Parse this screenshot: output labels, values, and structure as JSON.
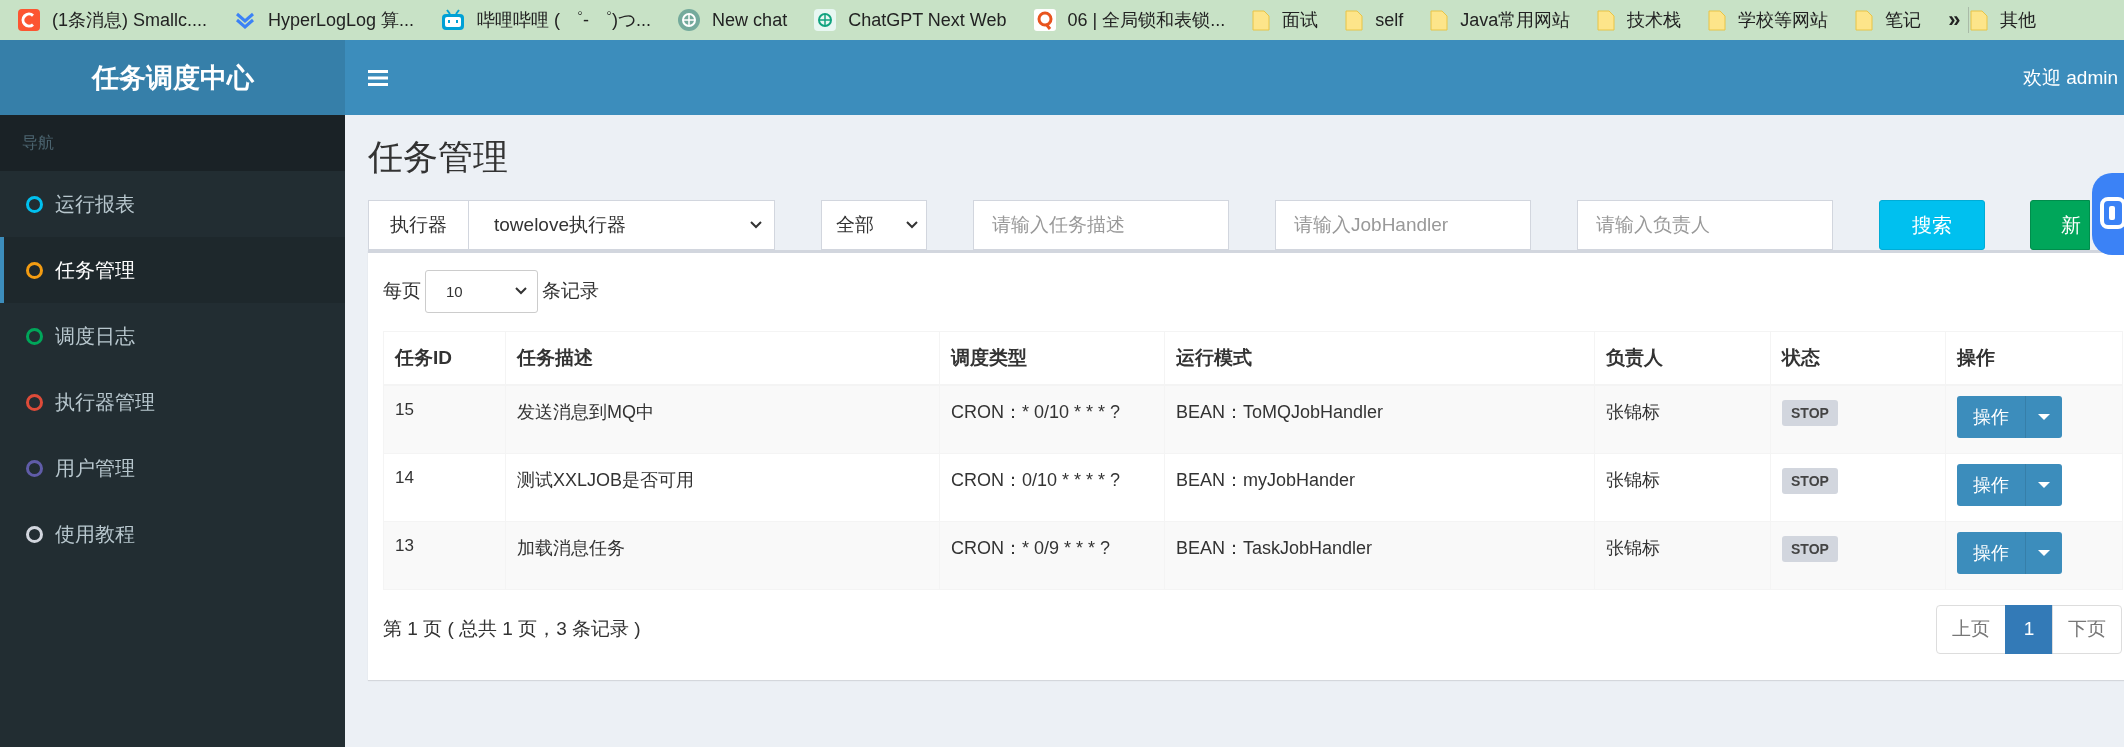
{
  "bookmarks": [
    {
      "label": "(1条消息) Smallc....",
      "kind": "red-square"
    },
    {
      "label": "HyperLogLog 算...",
      "kind": "chevrons"
    },
    {
      "label": "哔哩哔哩 ( ゜- ゜)つ...",
      "kind": "tv"
    },
    {
      "label": "New chat",
      "kind": "swirl-dark"
    },
    {
      "label": "ChatGPT Next Web",
      "kind": "swirl-light"
    },
    {
      "label": "06 | 全局锁和表锁...",
      "kind": "orange-ring"
    },
    {
      "label": "面试",
      "kind": "folder"
    },
    {
      "label": "self",
      "kind": "folder"
    },
    {
      "label": "Java常用网站",
      "kind": "folder"
    },
    {
      "label": "技术栈",
      "kind": "folder"
    },
    {
      "label": "学校等网站",
      "kind": "folder"
    },
    {
      "label": "笔记",
      "kind": "folder"
    }
  ],
  "bookmarks_more": "»",
  "bookmarks_other": {
    "label": "其他"
  },
  "brand": "任务调度中心",
  "welcome": "欢迎 admin",
  "sidebar": {
    "header": "导航",
    "items": [
      {
        "label": "运行报表",
        "color": "#00c0ef",
        "selected": false
      },
      {
        "label": "任务管理",
        "color": "#f39c12",
        "selected": true
      },
      {
        "label": "调度日志",
        "color": "#00a65a",
        "selected": false
      },
      {
        "label": "执行器管理",
        "color": "#dd4b39",
        "selected": false
      },
      {
        "label": "用户管理",
        "color": "#605ca8",
        "selected": false
      },
      {
        "label": "使用教程",
        "color": "#d2d6de",
        "selected": false
      }
    ]
  },
  "page_title": "任务管理",
  "filters": {
    "executor_label": "执行器",
    "executor_value": "towelove执行器",
    "status_value": "全部",
    "inputs": [
      {
        "placeholder": "请输入任务描述"
      },
      {
        "placeholder": "请输入JobHandler"
      },
      {
        "placeholder": "请输入负责人"
      }
    ],
    "buttons": [
      {
        "label": "搜索",
        "kind": "search"
      },
      {
        "label": "新",
        "kind": "add"
      }
    ]
  },
  "table": {
    "page_size_prefix": "每页",
    "page_size": "10",
    "page_size_suffix": "条记录",
    "columns": [
      "任务ID",
      "任务描述",
      "调度类型",
      "运行模式",
      "负责人",
      "状态",
      "操作"
    ],
    "rows": [
      {
        "cells": [
          "15",
          "发送消息到MQ中",
          "CRON：* 0/10 * * * ?",
          "BEAN：ToMQJobHandler",
          "张锦标"
        ],
        "status": "STOP",
        "action": "操作"
      },
      {
        "cells": [
          "14",
          "测试XXLJOB是否可用",
          "CRON：0/10 * * * * ?",
          "BEAN：myJobHander",
          "张锦标"
        ],
        "status": "STOP",
        "action": "操作"
      },
      {
        "cells": [
          "13",
          "加载消息任务",
          "CRON：* 0/9 * * * ?",
          "BEAN：TaskJobHandler",
          "张锦标"
        ],
        "status": "STOP",
        "action": "操作"
      }
    ]
  },
  "footer": {
    "info": "第 1 页 ( 总共 1 页，3 条记录 )",
    "pages": [
      {
        "label": "上页",
        "selected": false
      },
      {
        "label": "1",
        "selected": true
      },
      {
        "label": "下页",
        "selected": false
      }
    ]
  }
}
